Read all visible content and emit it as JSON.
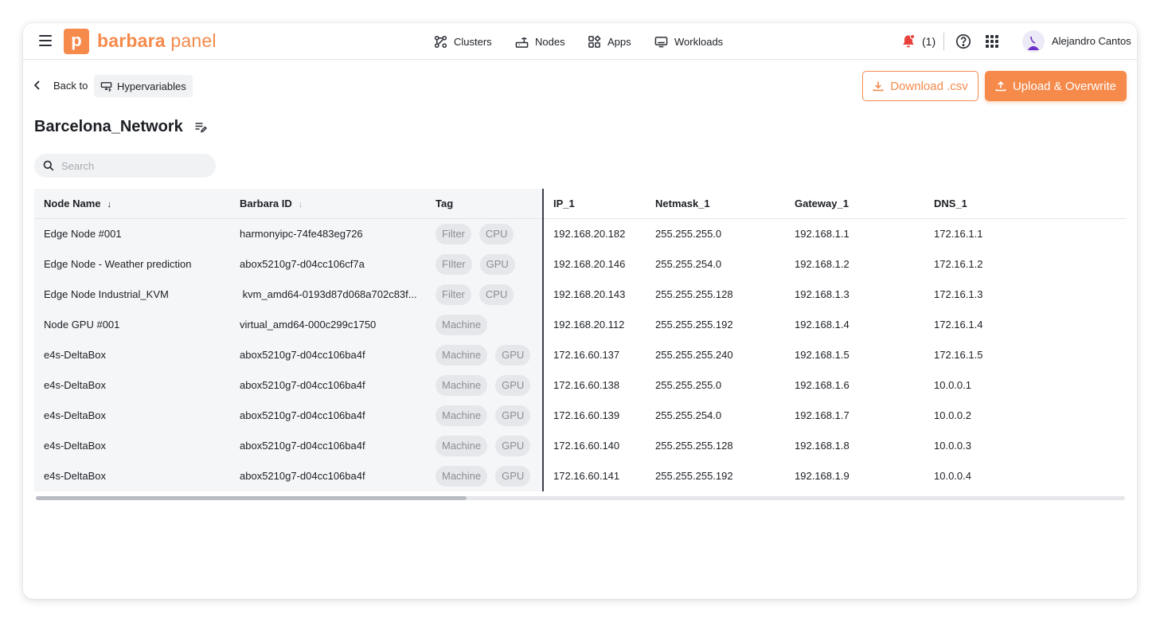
{
  "app": {
    "logo_letter": "p",
    "logo_bold": "barbara",
    "logo_light": " panel"
  },
  "nav": {
    "clusters": "Clusters",
    "nodes": "Nodes",
    "apps": "Apps",
    "workloads": "Workloads"
  },
  "notifications": {
    "count": "(1)"
  },
  "user": {
    "name": "Alejandro Cantos"
  },
  "breadcrumb": {
    "back": "Back to",
    "target": "Hypervariables"
  },
  "actions": {
    "download": "Download .csv",
    "upload": "Upload & Overwrite"
  },
  "page": {
    "title": "Barcelona_Network"
  },
  "search": {
    "placeholder": "Search"
  },
  "table": {
    "columns": [
      "Node Name",
      "Barbara ID",
      "Tag",
      "IP_1",
      "Netmask_1",
      "Gateway_1",
      "DNS_1"
    ],
    "rows": [
      {
        "name": "Edge Node #001",
        "id": "harmonyipc-74fe483eg726",
        "tags": [
          "Filter",
          "CPU"
        ],
        "ip": "192.168.20.182",
        "netmask": "255.255.255.0",
        "gateway": "192.168.1.1",
        "dns": "172.16.1.1"
      },
      {
        "name": "Edge Node - Weather prediction",
        "id": "abox5210g7-d04cc106cf7a",
        "tags": [
          "FIlter",
          "GPU"
        ],
        "ip": "192.168.20.146",
        "netmask": "255.255.254.0",
        "gateway": "192.168.1.2",
        "dns": "172.16.1.2"
      },
      {
        "name": "Edge Node Industrial_KVM",
        "id": " kvm_amd64-0193d87d068a702c83f...",
        "tags": [
          "Filter",
          "CPU"
        ],
        "ip": "192.168.20.143",
        "netmask": "255.255.255.128",
        "gateway": "192.168.1.3",
        "dns": "172.16.1.3"
      },
      {
        "name": "Node GPU #001",
        "id": "virtual_amd64-000c299c1750",
        "tags": [
          "Machine"
        ],
        "ip": "192.168.20.112",
        "netmask": "255.255.255.192",
        "gateway": "192.168.1.4",
        "dns": "172.16.1.4"
      },
      {
        "name": "e4s-DeltaBox",
        "id": "abox5210g7-d04cc106ba4f",
        "tags": [
          "Machine",
          "GPU"
        ],
        "ip": "172.16.60.137",
        "netmask": "255.255.255.240",
        "gateway": "192.168.1.5",
        "dns": "172.16.1.5"
      },
      {
        "name": "e4s-DeltaBox",
        "id": "abox5210g7-d04cc106ba4f",
        "tags": [
          "Machine",
          "GPU"
        ],
        "ip": "172.16.60.138",
        "netmask": "255.255.255.0",
        "gateway": "192.168.1.6",
        "dns": "10.0.0.1"
      },
      {
        "name": "e4s-DeltaBox",
        "id": "abox5210g7-d04cc106ba4f",
        "tags": [
          "Machine",
          "GPU"
        ],
        "ip": "172.16.60.139",
        "netmask": "255.255.254.0",
        "gateway": "192.168.1.7",
        "dns": "10.0.0.2"
      },
      {
        "name": "e4s-DeltaBox",
        "id": "abox5210g7-d04cc106ba4f",
        "tags": [
          "Machine",
          "GPU"
        ],
        "ip": "172.16.60.140",
        "netmask": "255.255.255.128",
        "gateway": "192.168.1.8",
        "dns": "10.0.0.3"
      },
      {
        "name": "e4s-DeltaBox",
        "id": "abox5210g7-d04cc106ba4f",
        "tags": [
          "Machine",
          "GPU"
        ],
        "ip": "172.16.60.141",
        "netmask": "255.255.255.192",
        "gateway": "192.168.1.9",
        "dns": "10.0.0.4"
      }
    ]
  },
  "colors": {
    "brand": "#f58a4b",
    "notification": "#e8413c",
    "frozen_bg": "#f5f6f8"
  }
}
